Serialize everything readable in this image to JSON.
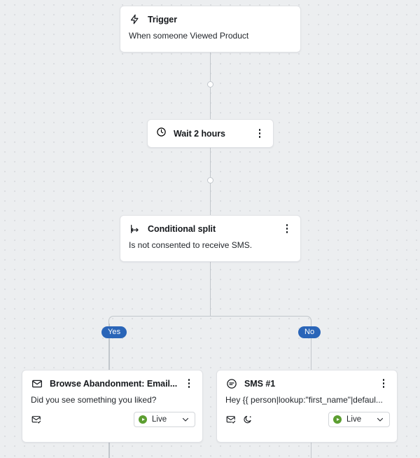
{
  "canvas": {
    "background_color": "#eceef0",
    "dot_color": "#dcdee1",
    "connector_color": "#c2c7cc"
  },
  "branches": {
    "yes_label": "Yes",
    "no_label": "No",
    "pill_color": "#2a65b8"
  },
  "nodes": {
    "trigger": {
      "icon": "lightning-bolt-icon",
      "title": "Trigger",
      "body": "When someone Viewed Product"
    },
    "wait": {
      "icon": "clock-icon",
      "title": "Wait 2 hours"
    },
    "conditional_split": {
      "icon": "split-branch-icon",
      "title": "Conditional split",
      "body": "Is not consented to receive SMS."
    },
    "email": {
      "icon": "envelope-icon",
      "title": "Browse Abandonment: Email...",
      "body": "Did you see something you liked?",
      "footer_icons": [
        "envelope-check-icon"
      ],
      "status": {
        "label": "Live",
        "color": "#5c9e31"
      }
    },
    "sms": {
      "icon": "chat-bubble-icon",
      "title": "SMS #1",
      "body": "Hey {{ person|lookup:\"first_name\"|defaul...",
      "footer_icons": [
        "envelope-check-icon",
        "moon-smart-sending-icon"
      ],
      "status": {
        "label": "Live",
        "color": "#5c9e31"
      }
    }
  }
}
